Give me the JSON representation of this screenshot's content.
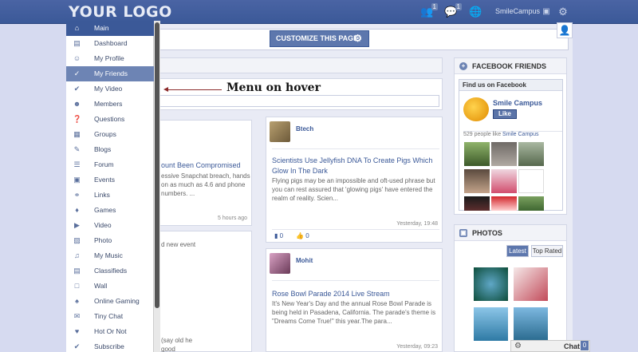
{
  "header": {
    "logo": "YOUR LOGO",
    "friend_requests_count": "1",
    "messages_count": "1",
    "user_name": "SmileCampus"
  },
  "toolbar": {
    "customize_label": "CUSTOMIZE THIS PAGE"
  },
  "annotation": "Menu on hover",
  "menu": {
    "items": [
      {
        "label": "Main",
        "icon": "home-icon"
      },
      {
        "label": "Dashboard",
        "icon": "dashboard-icon"
      },
      {
        "label": "My Profile",
        "icon": "profile-icon"
      },
      {
        "label": "My Friends",
        "icon": "friends-icon"
      },
      {
        "label": "My Video",
        "icon": "video-check-icon"
      },
      {
        "label": "Members",
        "icon": "members-icon"
      },
      {
        "label": "Questions",
        "icon": "questions-icon"
      },
      {
        "label": "Groups",
        "icon": "groups-icon"
      },
      {
        "label": "Blogs",
        "icon": "blogs-icon"
      },
      {
        "label": "Forum",
        "icon": "forum-icon"
      },
      {
        "label": "Events",
        "icon": "events-icon"
      },
      {
        "label": "Links",
        "icon": "links-icon"
      },
      {
        "label": "Games",
        "icon": "games-icon"
      },
      {
        "label": "Video",
        "icon": "video-icon"
      },
      {
        "label": "Photo",
        "icon": "photo-icon"
      },
      {
        "label": "My Music",
        "icon": "music-icon"
      },
      {
        "label": "Classifieds",
        "icon": "classifieds-icon"
      },
      {
        "label": "Wall",
        "icon": "wall-icon"
      },
      {
        "label": "Online Gaming",
        "icon": "online-gaming-icon"
      },
      {
        "label": "Tiny Chat",
        "icon": "chat-icon"
      },
      {
        "label": "Hot Or Not",
        "icon": "hot-icon"
      },
      {
        "label": "Subscribe",
        "icon": "subscribe-icon"
      }
    ]
  },
  "left_feed": {
    "card1_title": "ount Been Compromised",
    "card1_text": "essive Snapchat breach, hands on as much as 4.6 and phone numbers. ...",
    "card1_time": "5 hours ago",
    "card2_text": "d new event",
    "card3_text": "(say old he good"
  },
  "feed": [
    {
      "user": "Btech",
      "title": "Scientists Use Jellyfish DNA To Create Pigs Which Glow In The Dark",
      "text": "Flying pigs may be an impossible and oft-used phrase but you can rest assured that 'glowing pigs' have entered the realm of reality. Scien...",
      "time": "Yesterday, 19:48",
      "comments": "0",
      "likes": "0"
    },
    {
      "user": "Mohit",
      "title": "Rose Bowl Parade 2014 Live Stream",
      "text": "It's New Year's Day and the annual Rose Bowl Parade is being held in Pasadena, California. The parade's theme is \"Dreams Come True!\" this year.The para...",
      "time": "Yesterday, 09:23"
    }
  ],
  "facebook_friends": {
    "heading": "FACEBOOK FRIENDS",
    "find_us": "Find us on Facebook",
    "page_name": "Smile Campus",
    "like_button": "Like",
    "people_like_prefix": "529 people like ",
    "people_like_page": "Smile Campus"
  },
  "photos": {
    "heading": "PHOTOS",
    "tab_latest": "Latest",
    "tab_top_rated": "Top Rated"
  },
  "chat": {
    "label": "Chat",
    "count": "0"
  },
  "colors": {
    "brand": "#3b5998",
    "hover": "#6d84b4"
  }
}
